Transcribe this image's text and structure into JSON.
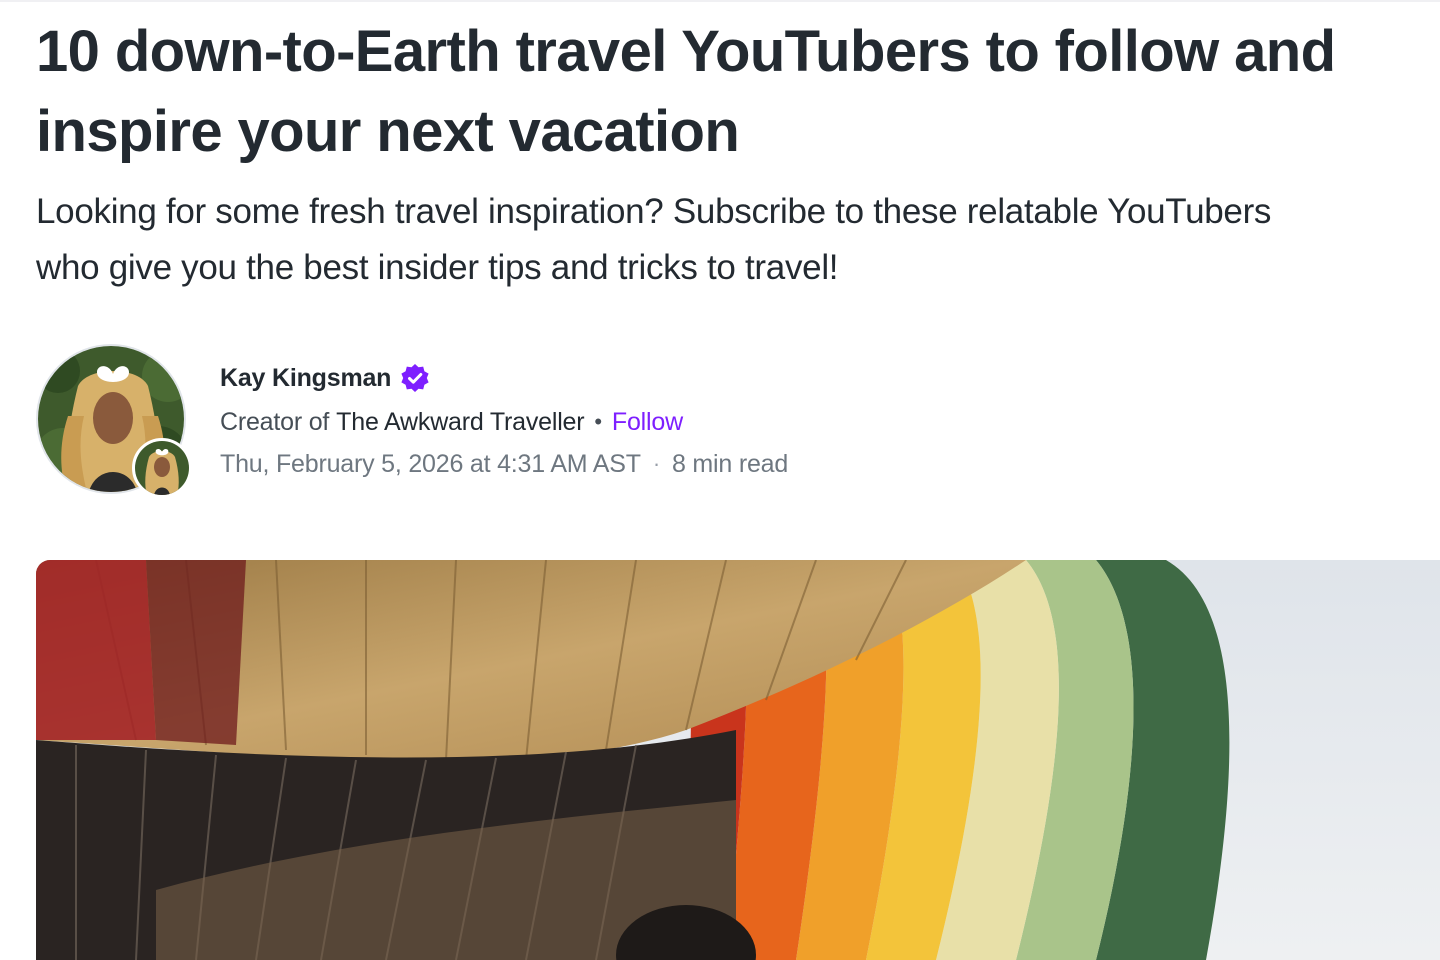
{
  "article": {
    "headline_line1": "10 down-to-Earth travel YouTubers to follow and",
    "headline_line2": "inspire your next vacation",
    "subhead_line1": "Looking for some fresh travel inspiration? Subscribe to these relatable YouTubers",
    "subhead_line2": "who give you the best insider tips and tricks to travel!"
  },
  "author": {
    "name": "Kay Kingsman",
    "verified_icon": "verified-badge-icon",
    "creator_prefix": "Creator of",
    "publication": "The Awkward Traveller",
    "separator": "•",
    "follow_label": "Follow",
    "date": "Thu, February 5, 2026 at 4:31 AM AST",
    "meta_separator": "·",
    "read_time": "8 min read"
  },
  "colors": {
    "text": "#232a31",
    "muted": "#6e7780",
    "accent": "#7e1fff",
    "verified": "#7e1fff"
  },
  "hero_image": {
    "alt": ""
  }
}
